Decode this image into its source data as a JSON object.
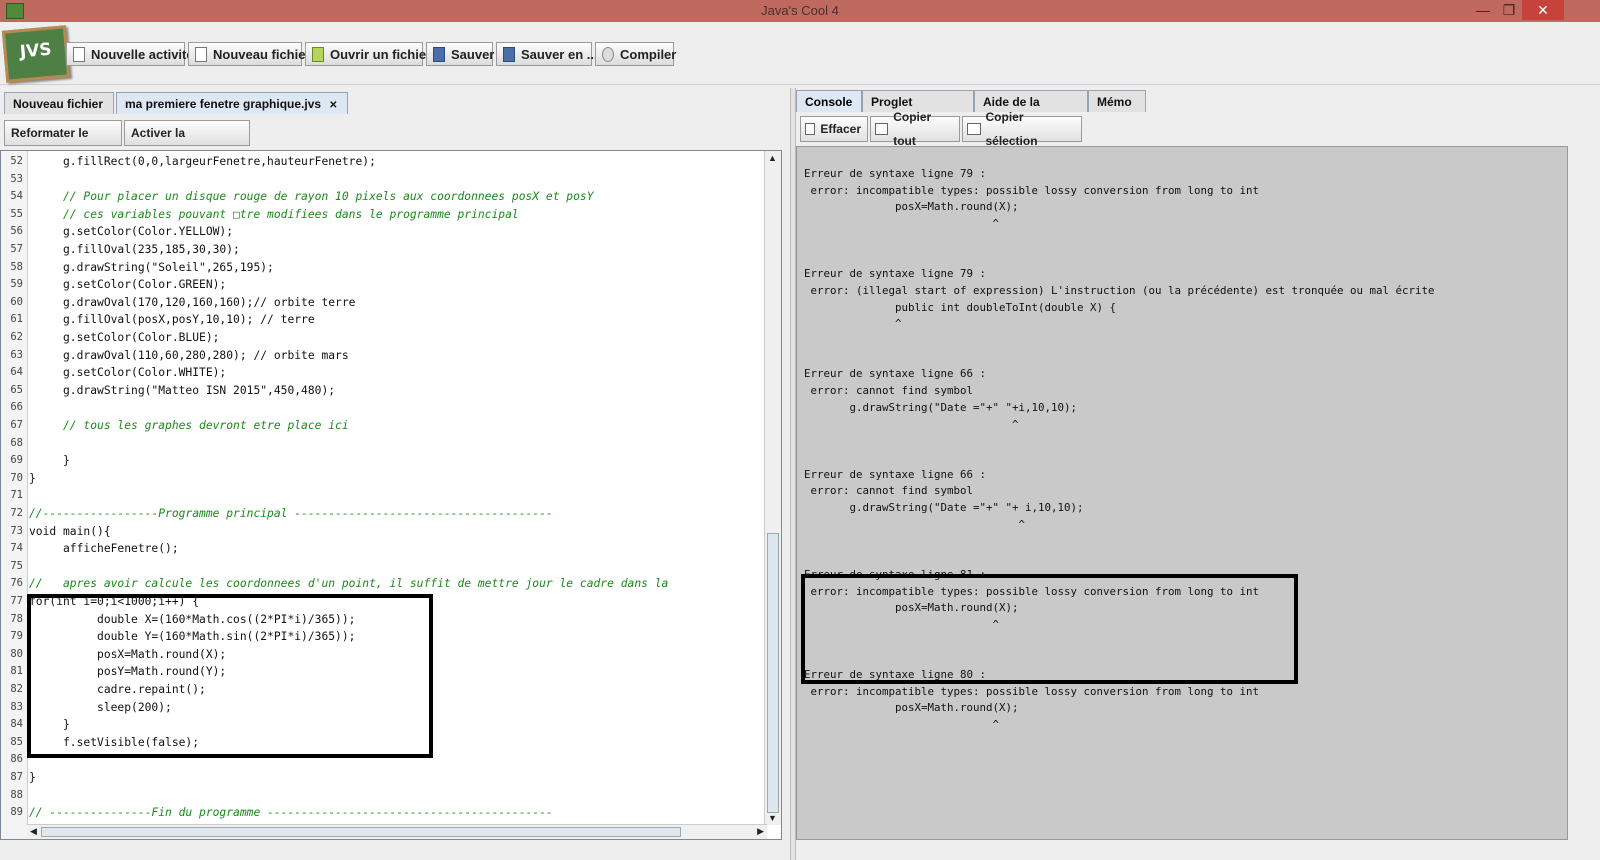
{
  "window": {
    "title": "Java's Cool 4",
    "minimize": "—",
    "restore": "❐",
    "close": "✕"
  },
  "logo_text": "JVS",
  "toolbar": {
    "new_activity": "Nouvelle activité",
    "new_file": "Nouveau fichier",
    "open_file": "Ouvrir un fichier",
    "save": "Sauver",
    "save_as": "Sauver en ...",
    "compile": "Compiler"
  },
  "editor_tabs": [
    {
      "label": "Nouveau fichier",
      "active": false
    },
    {
      "label": "ma premiere fenetre graphique.jvs",
      "active": true,
      "close": "✕"
    }
  ],
  "editor_buttons": {
    "reformat": "Reformater le code",
    "completion": "Activer la complétion"
  },
  "code_lines": [
    {
      "n": "52",
      "text": "     g.fillRect(0,0,largeurFenetre,hauteurFenetre);"
    },
    {
      "n": "53",
      "text": ""
    },
    {
      "n": "54",
      "text": "     // Pour placer un disque rouge de rayon 10 pixels aux coordonnees posX et posY"
    },
    {
      "n": "55",
      "text": "     // ces variables pouvant □tre modifiees dans le programme principal"
    },
    {
      "n": "56",
      "text": "     g.setColor(Color.YELLOW);"
    },
    {
      "n": "57",
      "text": "     g.fillOval(235,185,30,30);"
    },
    {
      "n": "58",
      "text": "     g.drawString(\"Soleil\",265,195);"
    },
    {
      "n": "59",
      "text": "     g.setColor(Color.GREEN);"
    },
    {
      "n": "60",
      "text": "     g.drawOval(170,120,160,160);// orbite terre"
    },
    {
      "n": "61",
      "text": "     g.fillOval(posX,posY,10,10); // terre"
    },
    {
      "n": "62",
      "text": "     g.setColor(Color.BLUE);"
    },
    {
      "n": "63",
      "text": "     g.drawOval(110,60,280,280); // orbite mars"
    },
    {
      "n": "64",
      "text": "     g.setColor(Color.WHITE);"
    },
    {
      "n": "65",
      "text": "     g.drawString(\"Matteo ISN 2015\",450,480);"
    },
    {
      "n": "66",
      "text": ""
    },
    {
      "n": "67",
      "text": "     // tous les graphes devront etre place ici"
    },
    {
      "n": "68",
      "text": ""
    },
    {
      "n": "69",
      "text": "     }"
    },
    {
      "n": "70",
      "text": "}"
    },
    {
      "n": "71",
      "text": ""
    },
    {
      "n": "72",
      "text": "//-----------------Programme principal --------------------------------------"
    },
    {
      "n": "73",
      "text": "void main(){"
    },
    {
      "n": "74",
      "text": "     afficheFenetre();"
    },
    {
      "n": "75",
      "text": ""
    },
    {
      "n": "76",
      "text": "//   apres avoir calcule les coordonnees d'un point, il suffit de mettre jour le cadre dans la"
    },
    {
      "n": "77",
      "text": "for(int i=0;i<1000;i++) {"
    },
    {
      "n": "78",
      "text": "          double X=(160*Math.cos((2*PI*i)/365));"
    },
    {
      "n": "79",
      "text": "          double Y=(160*Math.sin((2*PI*i)/365));"
    },
    {
      "n": "80",
      "text": "          posX=Math.round(X);"
    },
    {
      "n": "81",
      "text": "          posY=Math.round(Y);"
    },
    {
      "n": "82",
      "text": "          cadre.repaint();"
    },
    {
      "n": "83",
      "text": "          sleep(200);"
    },
    {
      "n": "84",
      "text": "     }"
    },
    {
      "n": "85",
      "text": "     f.setVisible(false);"
    },
    {
      "n": "86",
      "text": ""
    },
    {
      "n": "87",
      "text": "}"
    },
    {
      "n": "88",
      "text": ""
    },
    {
      "n": "89",
      "text": "// ---------------Fin du programme ------------------------------------------"
    }
  ],
  "right_tabs": [
    {
      "label": "Console",
      "active": true
    },
    {
      "label": "Proglet javaProg",
      "active": false
    },
    {
      "label": "Aide de la proglet",
      "active": false
    },
    {
      "label": "Mémo",
      "active": false
    }
  ],
  "console_buttons": {
    "clear": "Effacer",
    "copy_all": "Copier tout",
    "copy_selection": "Copier sélection"
  },
  "console_lines": [
    "Erreur de syntaxe ligne 79 :",
    " error: incompatible types: possible lossy conversion from long to int",
    "              posX=Math.round(X);",
    "                             ^",
    "",
    "",
    "Erreur de syntaxe ligne 79 :",
    " error: (illegal start of expression) L'instruction (ou la précédente) est tronquée ou mal écrite",
    "              public int doubleToInt(double X) {",
    "              ^",
    "",
    "",
    "Erreur de syntaxe ligne 66 :",
    " error: cannot find symbol",
    "       g.drawString(\"Date =\"+\" \"+i,10,10);",
    "                                ^",
    "",
    "",
    "Erreur de syntaxe ligne 66 :",
    " error: cannot find symbol",
    "       g.drawString(\"Date =\"+\" \"+ i,10,10);",
    "                                 ^",
    "",
    "",
    "Erreur de syntaxe ligne 81 :",
    " error: incompatible types: possible lossy conversion from long to int",
    "              posX=Math.round(X);",
    "                             ^",
    "",
    "",
    "Erreur de syntaxe ligne 80 :",
    " error: incompatible types: possible lossy conversion from long to int",
    "              posX=Math.round(X);",
    "                             ^"
  ]
}
